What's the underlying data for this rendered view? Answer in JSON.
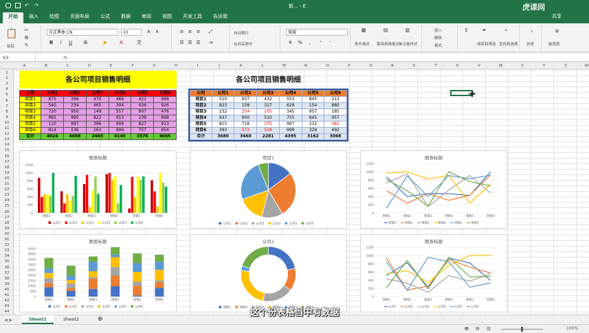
{
  "titlebar": {
    "title": "新... - E",
    "brand": "虎课网"
  },
  "menu": {
    "tabs": [
      "开始",
      "插入",
      "绘图",
      "页面布局",
      "公式",
      "数据",
      "审阅",
      "视图",
      "开发工具",
      "告诉我"
    ],
    "share": "共享"
  },
  "ribbon": {
    "font_name": "方正黑体 CN",
    "font_size": "10",
    "number_format": "常规",
    "wrap_text": "自动换行",
    "merge_center": "合并后居中",
    "paste": "粘贴",
    "labels": {
      "cond_format": "条件格式",
      "table_format": "套用表格格式",
      "cell_style": "单元格样式",
      "insert": "插入",
      "delete": "删除",
      "format": "格式",
      "sort_filter": "排序和筛选",
      "find_select": "查找和选择",
      "ideas": "创意",
      "sensitivity": "敏感度"
    }
  },
  "formula_bar": {
    "name_box": "V3",
    "fx": "fx",
    "content": ""
  },
  "columns": [
    "A",
    "B",
    "C",
    "D",
    "E",
    "F",
    "G",
    "H",
    "I",
    "J",
    "K",
    "L",
    "M",
    "N",
    "O",
    "P",
    "Q",
    "R",
    "S",
    "T",
    "U",
    "V",
    "W",
    "X",
    "Y",
    "Z",
    "AA"
  ],
  "rows": [
    "1",
    "2",
    "3",
    "4",
    "5",
    "6",
    "7",
    "8",
    "9",
    "10",
    "11",
    "12",
    "13",
    "14",
    "15",
    "16",
    "17",
    "18",
    "19",
    "20",
    "21",
    "22",
    "23",
    "24",
    "25",
    "26",
    "27",
    "28",
    "29",
    "30",
    "31",
    "32",
    "33",
    "34",
    "35",
    "36",
    "37",
    "38",
    "39",
    "40",
    "41",
    "42",
    "43",
    "44"
  ],
  "table1": {
    "title": "各公司项目销售明细",
    "header": [
      "公司",
      "公司1",
      "公司2",
      "公司3",
      "公司4",
      "公司5",
      "公司6"
    ],
    "rows": [
      [
        "项目1",
        "875",
        "396",
        "470",
        "466",
        "421",
        "998"
      ],
      [
        "项目2",
        "540",
        "234",
        "465",
        "304",
        "426",
        "926"
      ],
      [
        "项目3",
        "720",
        "950",
        "149",
        "557",
        "907",
        "476"
      ],
      [
        "项目4",
        "965",
        "995",
        "822",
        "913",
        "238",
        "698"
      ],
      [
        "项目5",
        "110",
        "897",
        "396",
        "906",
        "827",
        "913"
      ],
      [
        "项目6",
        "814",
        "536",
        "163",
        "999",
        "757",
        "654"
      ]
    ],
    "total": [
      "合计",
      "4024",
      "4008",
      "2465",
      "4145",
      "3576",
      "4665"
    ],
    "colors": {
      "title_bg": "#ffff00",
      "header_bg": "#ff0000",
      "rows_bg": "#e6a0e6",
      "total_bg": "#66cc33",
      "first_col_bg": "#ffff00"
    }
  },
  "table2": {
    "title": "各公司项目销售明细",
    "header": [
      "公司",
      "公司1",
      "公司2",
      "公司3",
      "公司4",
      "公司5",
      "公司6"
    ],
    "rows": [
      [
        "项目1",
        "510",
        "937",
        "432",
        "553",
        "845",
        "213"
      ],
      [
        "项目2",
        "823",
        "158",
        "327",
        "628",
        "154",
        "880"
      ],
      [
        "项目3",
        "232",
        "254",
        "105",
        "345",
        "957",
        "185"
      ],
      [
        "项目4",
        "937",
        "900",
        "510",
        "755",
        "845",
        "957"
      ],
      [
        "项目5",
        "815",
        "718",
        "375",
        "997",
        "232",
        "481"
      ],
      [
        "项目6",
        "393",
        "573",
        "558",
        "999",
        "329",
        "492"
      ]
    ],
    "red_cells": [
      [
        2,
        2
      ],
      [
        2,
        3
      ],
      [
        4,
        3
      ],
      [
        4,
        6
      ],
      [
        5,
        2
      ],
      [
        5,
        3
      ]
    ],
    "total": [
      "合计",
      "3680",
      "3460",
      "2281",
      "4395",
      "3162",
      "3068"
    ],
    "colors": {
      "header_bg": "#ed7d31",
      "border": "#2f5597",
      "alt_bg": "#dde5f1"
    }
  },
  "charts": {
    "bar_title": "图表标题",
    "stacked_title": "图表标题",
    "pie_title": "项目1",
    "donut_title": "公司1",
    "line1_title": "图表标题",
    "line2_title": "图表标题",
    "series_colors": [
      "#4472c4",
      "#ed7d31",
      "#a5a5a5",
      "#ffc000",
      "#5b9bd5",
      "#70ad47"
    ],
    "bar_series_colors": [
      "#c00000",
      "#ff0000",
      "#ffc000",
      "#ffff00",
      "#92d050",
      "#00b050"
    ],
    "legend_companies": [
      "公司1",
      "公司2",
      "公司3",
      "公司4",
      "公司5",
      "公司6"
    ],
    "legend_projects": [
      "项目1",
      "项目2",
      "项目3",
      "项目4",
      "项目5",
      "项目6"
    ]
  },
  "chart_data": [
    {
      "type": "bar",
      "title": "图表标题",
      "categories": [
        "项目1",
        "项目2",
        "项目3",
        "项目4",
        "项目5",
        "项目6"
      ],
      "ylim": [
        0,
        1200
      ],
      "yticks": [
        "0",
        "200",
        "400",
        "600",
        "800",
        "1000",
        "1200"
      ],
      "series": [
        {
          "name": "公司1",
          "values": [
            875,
            540,
            720,
            965,
            110,
            814
          ]
        },
        {
          "name": "公司2",
          "values": [
            396,
            234,
            950,
            995,
            897,
            536
          ]
        },
        {
          "name": "公司3",
          "values": [
            470,
            465,
            149,
            822,
            396,
            163
          ]
        },
        {
          "name": "公司4",
          "values": [
            466,
            304,
            557,
            913,
            906,
            999
          ]
        },
        {
          "name": "公司5",
          "values": [
            421,
            426,
            907,
            238,
            827,
            757
          ]
        },
        {
          "name": "公司6",
          "values": [
            998,
            926,
            476,
            698,
            913,
            654
          ]
        }
      ]
    },
    {
      "type": "pie",
      "title": "项目1",
      "categories": [
        "公司1",
        "公司2",
        "公司3",
        "公司4",
        "公司5",
        "公司6"
      ],
      "values": [
        510,
        937,
        432,
        553,
        845,
        213
      ]
    },
    {
      "type": "line",
      "title": "图表标题",
      "categories": [
        "项目1",
        "项目2",
        "项目3",
        "项目4",
        "项目5",
        "项目6"
      ],
      "ylim": [
        0,
        1200
      ],
      "yticks": [
        "0",
        "200",
        "400",
        "600",
        "800",
        "1000",
        "1200"
      ],
      "series": [
        {
          "name": "项目1",
          "values": [
            875,
            396,
            470,
            466,
            421,
            998
          ]
        },
        {
          "name": "项目2",
          "values": [
            540,
            234,
            465,
            304,
            426,
            926
          ]
        },
        {
          "name": "项目3",
          "values": [
            720,
            950,
            149,
            557,
            907,
            476
          ]
        },
        {
          "name": "项目4",
          "values": [
            965,
            995,
            822,
            913,
            238,
            698
          ]
        },
        {
          "name": "项目5",
          "values": [
            110,
            897,
            396,
            906,
            827,
            913
          ]
        },
        {
          "name": "项目6",
          "values": [
            814,
            536,
            163,
            999,
            757,
            654
          ]
        }
      ]
    },
    {
      "type": "bar",
      "stacked": true,
      "title": "图表标题",
      "categories": [
        "项目1",
        "项目2",
        "项目3",
        "项目4",
        "项目5",
        "项目6"
      ],
      "ylim": [
        0,
        4500
      ],
      "yticks": [
        "0",
        "500",
        "1000",
        "1500",
        "2000",
        "2500",
        "3000",
        "3500",
        "4000",
        "4500"
      ],
      "series": [
        {
          "name": "公司1",
          "values": [
            875,
            540,
            720,
            965,
            110,
            814
          ]
        },
        {
          "name": "公司2",
          "values": [
            396,
            234,
            950,
            995,
            897,
            536
          ]
        },
        {
          "name": "公司3",
          "values": [
            470,
            465,
            149,
            822,
            396,
            163
          ]
        },
        {
          "name": "公司4",
          "values": [
            466,
            304,
            557,
            913,
            906,
            999
          ]
        },
        {
          "name": "公司5",
          "values": [
            421,
            426,
            907,
            238,
            827,
            757
          ]
        },
        {
          "name": "公司6",
          "values": [
            998,
            926,
            476,
            698,
            913,
            654
          ]
        }
      ]
    },
    {
      "type": "pie",
      "donut": true,
      "title": "公司1",
      "categories": [
        "项目1",
        "项目2",
        "项目3",
        "项目4",
        "项目5",
        "项目6"
      ],
      "values": [
        875,
        540,
        720,
        965,
        110,
        814
      ]
    },
    {
      "type": "line",
      "title": "图表标题",
      "categories": [
        "项目1",
        "项目2",
        "项目3",
        "项目4",
        "项目5",
        "项目6"
      ],
      "ylim": [
        0,
        1200
      ],
      "yticks": [
        "0",
        "200",
        "400",
        "600",
        "800",
        "1000",
        "1200"
      ],
      "series": [
        {
          "name": "公司1",
          "values": [
            510,
            823,
            232,
            937,
            815,
            393
          ]
        },
        {
          "name": "公司2",
          "values": [
            937,
            158,
            254,
            900,
            718,
            573
          ]
        },
        {
          "name": "公司3",
          "values": [
            432,
            327,
            105,
            510,
            375,
            558
          ]
        },
        {
          "name": "公司4",
          "values": [
            553,
            628,
            345,
            755,
            997,
            999
          ]
        },
        {
          "name": "公司5",
          "values": [
            845,
            154,
            957,
            845,
            232,
            329
          ]
        },
        {
          "name": "公司6",
          "values": [
            213,
            880,
            185,
            957,
            481,
            492
          ]
        }
      ]
    }
  ],
  "sheet_tabs": [
    "Sheet1",
    "Sheet2"
  ],
  "status": {
    "zoom": "100%"
  },
  "subtitle": "这个份表格当中有数据"
}
